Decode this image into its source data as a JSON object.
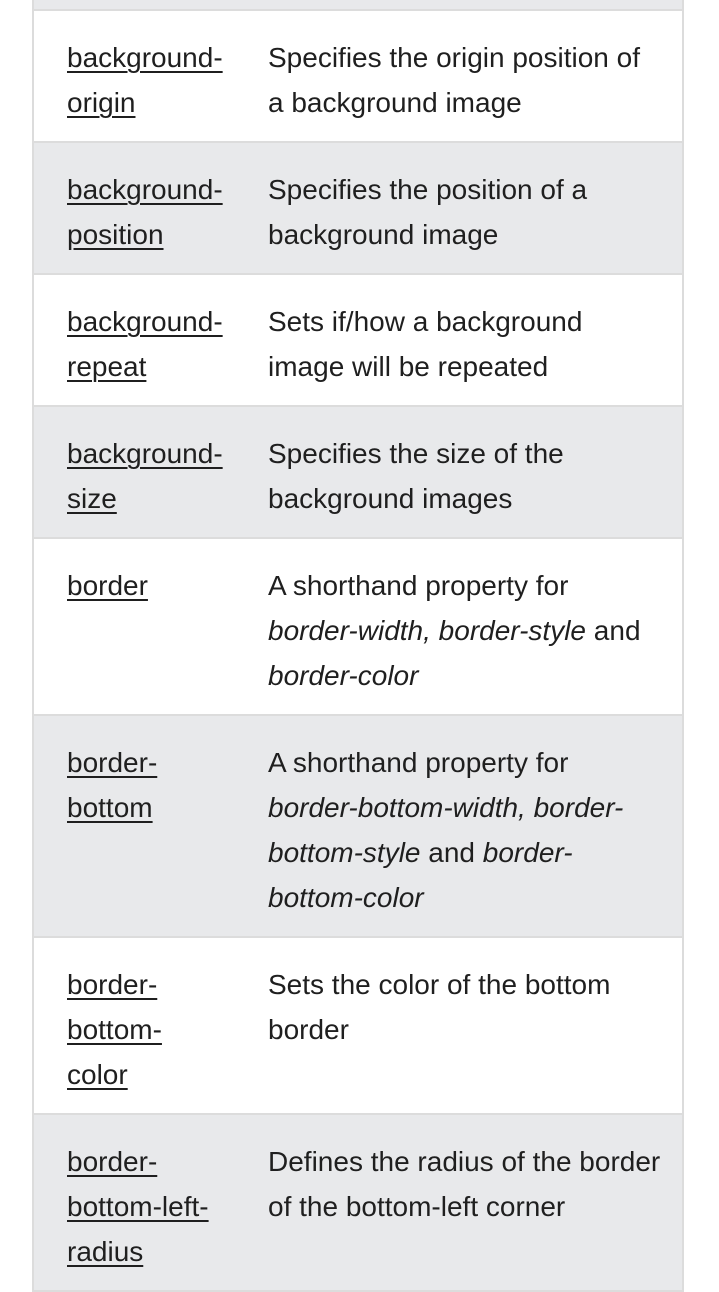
{
  "rows": [
    {
      "prop": [
        "background-",
        "origin"
      ],
      "desc": [
        {
          "t": "Specifies the origin position of a background image",
          "i": false
        }
      ],
      "shade": false
    },
    {
      "prop": [
        "background-",
        "position"
      ],
      "desc": [
        {
          "t": "Specifies the position of a background image",
          "i": false
        }
      ],
      "shade": true
    },
    {
      "prop": [
        "background-",
        "repeat"
      ],
      "desc": [
        {
          "t": "Sets if/how a background image will be repeated",
          "i": false
        }
      ],
      "shade": false
    },
    {
      "prop": [
        "background-",
        "size"
      ],
      "desc": [
        {
          "t": "Specifies the size of the background images",
          "i": false
        }
      ],
      "shade": true
    },
    {
      "prop": [
        "border"
      ],
      "desc": [
        {
          "t": "A shorthand property for ",
          "i": false
        },
        {
          "t": "border-width, border-style",
          "i": true
        },
        {
          "t": " and ",
          "i": false
        },
        {
          "t": "border-color",
          "i": true
        }
      ],
      "shade": false
    },
    {
      "prop": [
        "border-",
        "bottom"
      ],
      "desc": [
        {
          "t": "A shorthand property for ",
          "i": false
        },
        {
          "t": "border-bottom-width, border-bottom-style",
          "i": true
        },
        {
          "t": " and ",
          "i": false
        },
        {
          "t": "border-bottom-color",
          "i": true
        }
      ],
      "shade": true
    },
    {
      "prop": [
        "border-",
        "bottom-",
        "color"
      ],
      "desc": [
        {
          "t": "Sets the color of the bottom border",
          "i": false
        }
      ],
      "shade": false
    },
    {
      "prop": [
        "border-",
        "bottom-left-",
        "radius"
      ],
      "desc": [
        {
          "t": "Defines the radius of the border of the bottom-left corner",
          "i": false
        }
      ],
      "shade": true
    }
  ]
}
